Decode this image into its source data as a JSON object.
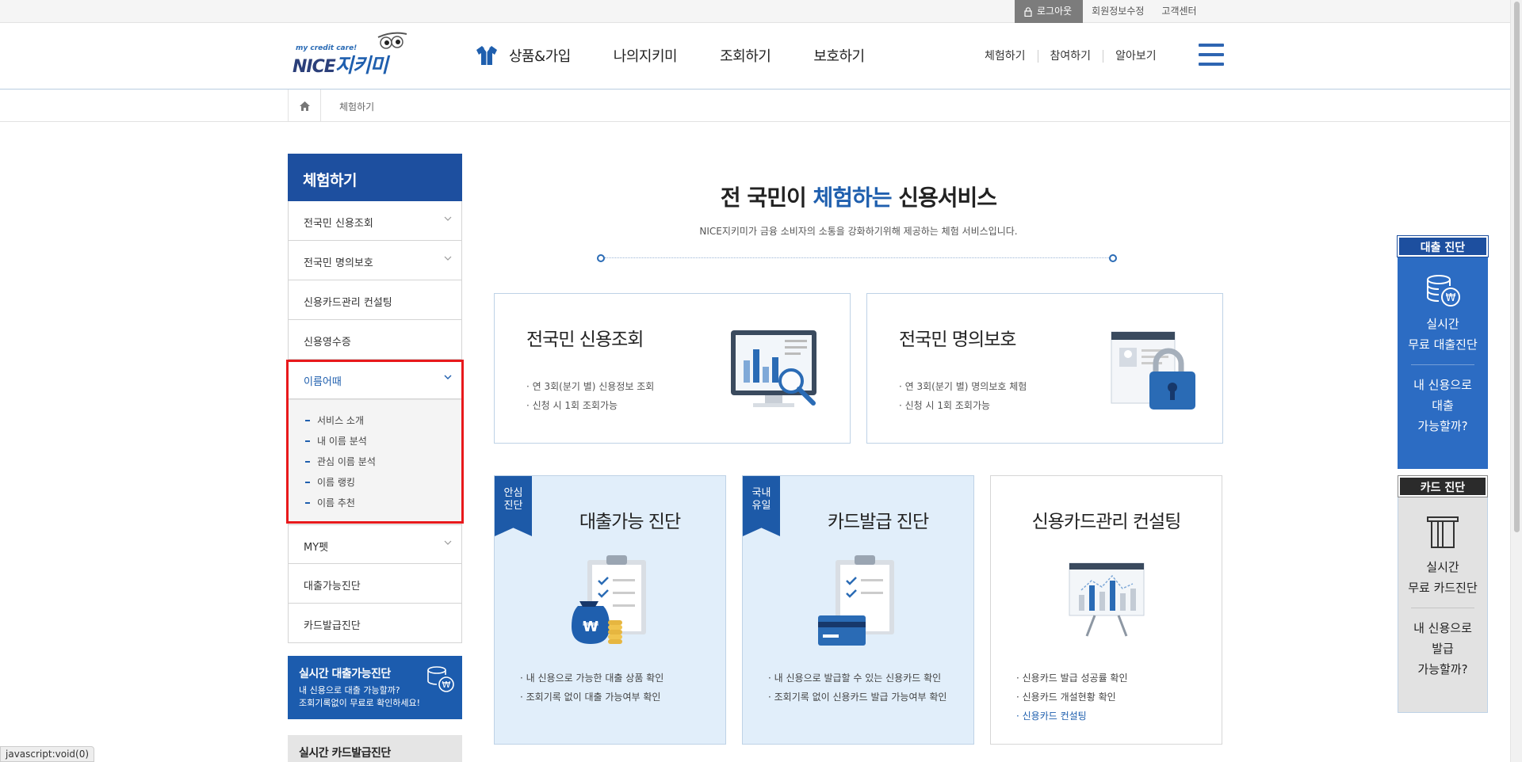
{
  "util": {
    "logout": "로그아웃",
    "member_edit": "회원정보수정",
    "customer_center": "고객센터"
  },
  "header": {
    "logo_tag": "my credit care!",
    "logo_nice": "NICE",
    "logo_brand": "지키미",
    "gnb": [
      "상품&가입",
      "나의지키미",
      "조회하기",
      "보호하기"
    ],
    "hnav": [
      "체험하기",
      "참여하기",
      "알아보기"
    ]
  },
  "breadcrumb": {
    "current": "체험하기"
  },
  "lnb": {
    "title": "체험하기",
    "items": [
      "전국민 신용조회",
      "전국민 명의보호",
      "신용카드관리 컨설팅",
      "신용영수증",
      "이름어때",
      "MY펫",
      "대출가능진단",
      "카드발급진단"
    ],
    "sub_items": [
      "서비스 소개",
      "내 이름 분석",
      "관심 이름 분석",
      "이름 랭킹",
      "이름 추천"
    ]
  },
  "promo": {
    "loan_title": "실시간 대출가능진단",
    "loan_desc1": "내 신용으로 대출 가능할까?",
    "loan_desc2": "조회기록없이 무료로 확인하세요!",
    "card_title": "실시간 카드발급진단"
  },
  "main": {
    "title_pre": "전 국민이 ",
    "title_hl": "체험하는",
    "title_post": " 신용서비스",
    "subtitle": "NICE지키미가 금융 소비자의 소통을 강화하기위해 제공하는 체험 서비스입니다."
  },
  "cards_top": [
    {
      "title": "전국민 신용조회",
      "desc1": "· 연 3회(분기 별) 신용정보 조회",
      "desc2": "· 신청 시 1회 조회가능"
    },
    {
      "title": "전국민 명의보호",
      "desc1": "· 연 3회(분기 별) 명의보호 체험",
      "desc2": "· 신청 시 1회 조회가능"
    }
  ],
  "cards_bottom": [
    {
      "ribbon1": "안심",
      "ribbon2": "진단",
      "title": "대출가능 진단",
      "desc1": "· 내 신용으로 가능한 대출 상품 확인",
      "desc2": "· 조회기록 없이 대출 가능여부 확인"
    },
    {
      "ribbon1": "국내",
      "ribbon2": "유일",
      "title": "카드발급 진단",
      "desc1": "· 내 신용으로 발급할 수 있는 신용카드 확인",
      "desc2": "· 조회기록 없이 신용카드 발급 가능여부 확인"
    },
    {
      "title": "신용카드관리 컨설팅",
      "desc1": "· 신용카드 발급 성공률 확인",
      "desc2": "· 신용카드 개설현황 확인",
      "link": "· 신용카드 컨설팅"
    }
  ],
  "float": {
    "loan_head": "대출 진단",
    "loan_l1": "실시간",
    "loan_l2": "무료 대출진단",
    "loan_q1": "내 신용으로",
    "loan_q2": "대출",
    "loan_q3": "가능할까?",
    "card_head": "카드 진단",
    "card_l1": "실시간",
    "card_l2": "무료 카드진단",
    "card_q1": "내 신용으로",
    "card_q2": "발급",
    "card_q3": "가능할까?"
  },
  "status_url": "javascript:void(0)",
  "colors": {
    "primary": "#1d4f9f",
    "accent": "#2c6cc3",
    "highlight": "#e8191c"
  }
}
